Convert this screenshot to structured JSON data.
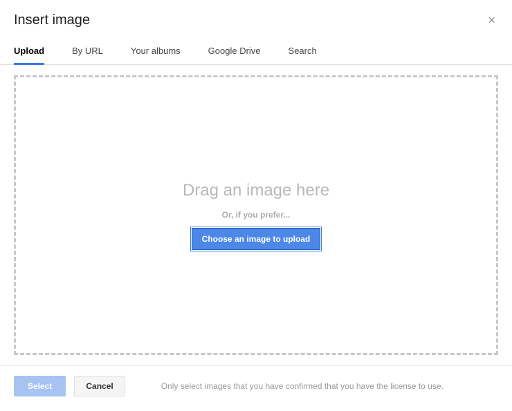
{
  "header": {
    "title": "Insert image",
    "close": "×"
  },
  "tabs": {
    "upload": "Upload",
    "byUrl": "By URL",
    "yourAlbums": "Your albums",
    "googleDrive": "Google Drive",
    "search": "Search"
  },
  "dropzone": {
    "dragText": "Drag an image here",
    "orText": "Or, if you prefer...",
    "chooseBtn": "Choose an image to upload"
  },
  "footer": {
    "select": "Select",
    "cancel": "Cancel",
    "disclaimer": "Only select images that you have confirmed that you have the license to use."
  }
}
